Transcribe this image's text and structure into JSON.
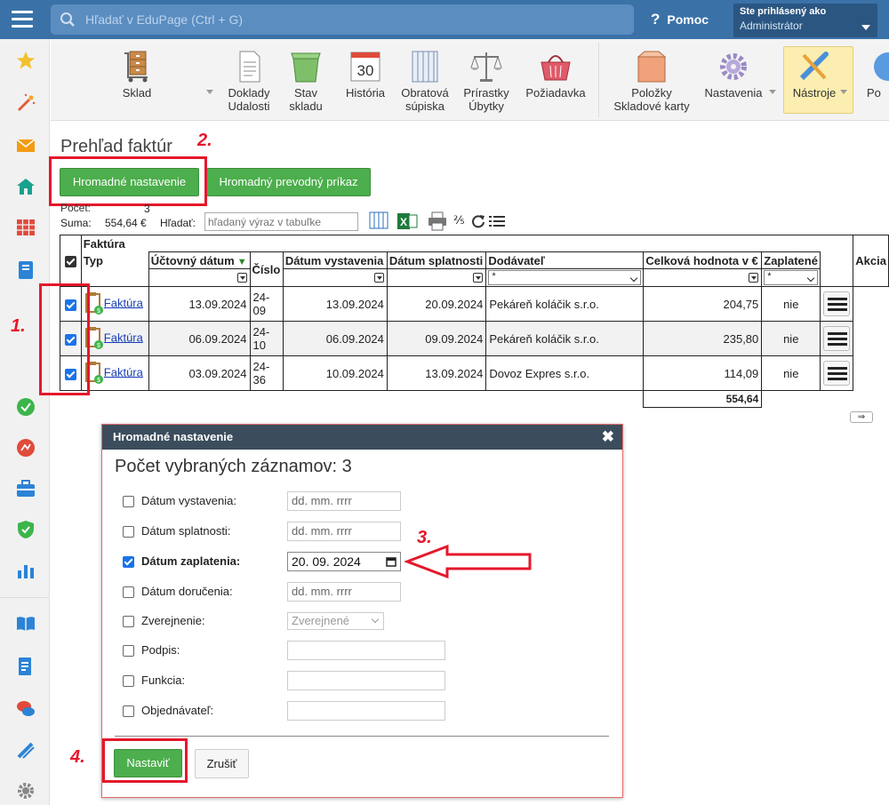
{
  "topbar": {
    "search_placeholder": "Hľadať v EduPage (Ctrl + G)",
    "help_label": "Pomoc",
    "user_line1": "Ste prihlásený ako",
    "user_line2": "Administrátor"
  },
  "toolbar": {
    "items": [
      {
        "label": "Sklad"
      },
      {
        "label": "Doklady\nUdalosti"
      },
      {
        "label": "Stav\nskladu"
      },
      {
        "label": "História"
      },
      {
        "label": "Obratová\nsúpiska"
      },
      {
        "label": "Prírastky\nÚbytky"
      },
      {
        "label": "Požiadavka"
      },
      {
        "label": "Položky\nSkladové karty"
      },
      {
        "label": "Nastavenia"
      },
      {
        "label": "Nástroje"
      },
      {
        "label": "Po"
      }
    ],
    "calendar_day": "30"
  },
  "main": {
    "title": "Prehľad faktúr",
    "btn_bulk_settings": "Hromadné nastavenie",
    "btn_bulk_transfer": "Hromadný prevodný príkaz",
    "count_label": "Počet:",
    "count_value": "3",
    "sum_label": "Suma:",
    "sum_value": "554,64 €",
    "search_label": "Hľadať:",
    "search_placeholder": "hľadaný výraz v tabuľke"
  },
  "annotations": {
    "a1": "1.",
    "a2": "2.",
    "a3": "3.",
    "a4": "4."
  },
  "table": {
    "group_header": "Faktúra",
    "columns": {
      "typ": "Typ",
      "uctovny_datum": "Účtovný dátum",
      "cislo": "Číslo",
      "datum_vystavenia": "Dátum vystavenia",
      "datum_splatnosti": "Dátum splatnosti",
      "dodavatel": "Dodávateľ",
      "hodnota": "Celková hodnota v €",
      "zaplatene": "Zaplatené",
      "akcia": "Akcia"
    },
    "filter_dodavatel": "*",
    "filter_zaplatene": "*",
    "rows": [
      {
        "typ": "Faktúra",
        "uctovny_datum": "13.09.2024",
        "cislo": "24-09",
        "datum_vystavenia": "13.09.2024",
        "datum_splatnosti": "20.09.2024",
        "dodavatel": "Pekáreň koláčik s.r.o.",
        "hodnota": "204,75",
        "zaplatene": "nie"
      },
      {
        "typ": "Faktúra",
        "uctovny_datum": "06.09.2024",
        "cislo": "24-10",
        "datum_vystavenia": "06.09.2024",
        "datum_splatnosti": "09.09.2024",
        "dodavatel": "Pekáreň koláčik s.r.o.",
        "hodnota": "235,80",
        "zaplatene": "nie"
      },
      {
        "typ": "Faktúra",
        "uctovny_datum": "03.09.2024",
        "cislo": "24-36",
        "datum_vystavenia": "10.09.2024",
        "datum_splatnosti": "13.09.2024",
        "dodavatel": "Dovoz Expres s.r.o.",
        "hodnota": "114,09",
        "zaplatene": "nie"
      }
    ],
    "total": "554,64"
  },
  "dialog": {
    "header": "Hromadné nastavenie",
    "title": "Počet vybraných záznamov: 3",
    "fields": {
      "datum_vystavenia": {
        "label": "Dátum vystavenia:",
        "value": "dd. mm. rrrr"
      },
      "datum_splatnosti": {
        "label": "Dátum splatnosti:",
        "value": "dd. mm. rrrr"
      },
      "datum_zaplatenia": {
        "label": "Dátum zaplatenia:",
        "value": "20. 09. 2024"
      },
      "datum_dorucenia": {
        "label": "Dátum doručenia:",
        "value": "dd. mm. rrrr"
      },
      "zverejnenie": {
        "label": "Zverejnenie:",
        "value": "Zverejnené"
      },
      "podpis": {
        "label": "Podpis:"
      },
      "funkcia": {
        "label": "Funkcia:"
      },
      "objednavatel": {
        "label": "Objednávateľ:"
      }
    },
    "btn_set": "Nastaviť",
    "btn_cancel": "Zrušiť"
  },
  "colors": {
    "topbar": "#3a72a8",
    "green": "#4cae4c",
    "annotation": "#e4182b",
    "dialog_header": "#3b4d5c"
  }
}
